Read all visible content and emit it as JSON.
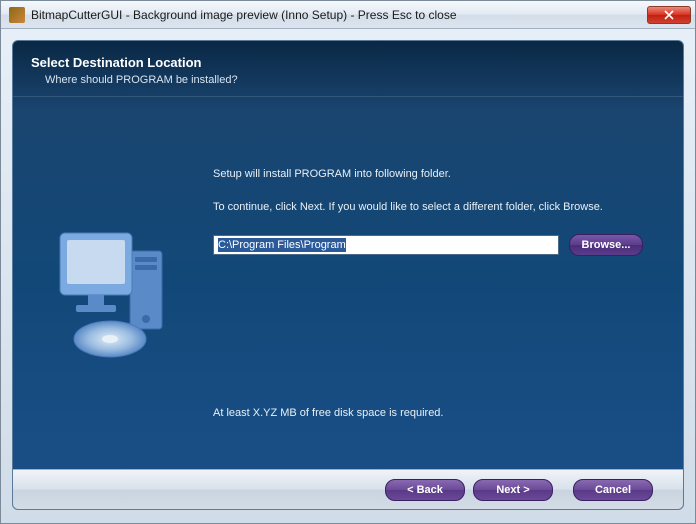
{
  "titlebar": {
    "text": "BitmapCutterGUI - Background image preview (Inno Setup) - Press Esc to close"
  },
  "header": {
    "title": "Select Destination Location",
    "subtitle": "Where should PROGRAM be installed?"
  },
  "content": {
    "install_text": "Setup will install PROGRAM into following folder.",
    "continue_text": "To continue, click Next. If you would like to select a different folder, click Browse.",
    "path_value": "C:\\Program Files\\Program",
    "browse_label": "Browse...",
    "space_required": "At least X.YZ MB of free disk space is required."
  },
  "footer": {
    "back_label": "< Back",
    "next_label": "Next >",
    "cancel_label": "Cancel"
  }
}
